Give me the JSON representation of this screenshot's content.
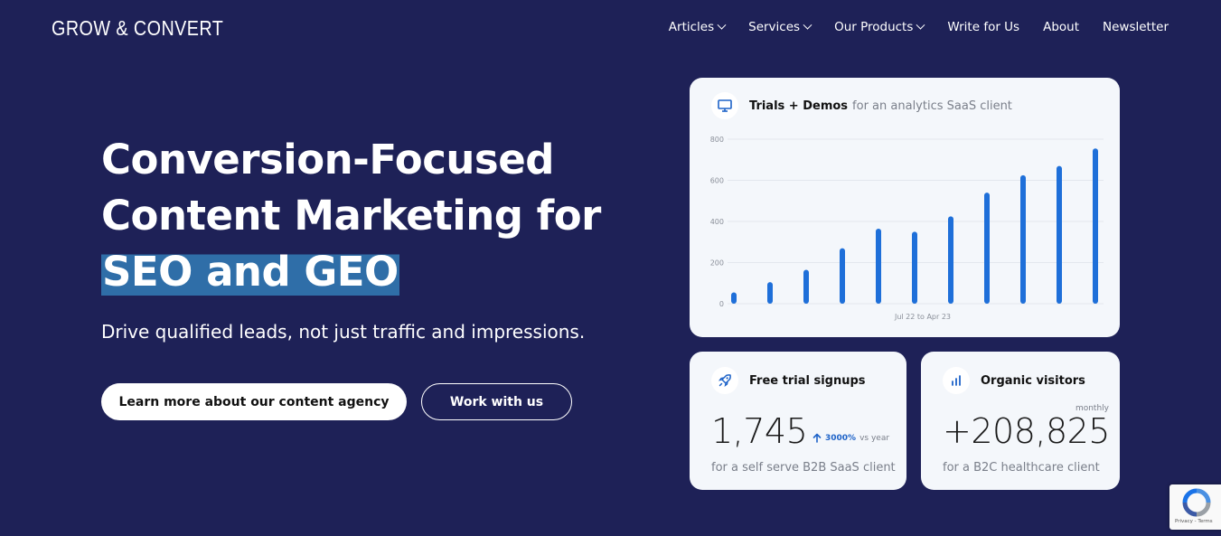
{
  "header": {
    "logo": "GROW & CONVERT",
    "nav": [
      {
        "label": "Articles",
        "dropdown": true
      },
      {
        "label": "Services",
        "dropdown": true
      },
      {
        "label": "Our Products",
        "dropdown": true
      },
      {
        "label": "Write for Us",
        "dropdown": false
      },
      {
        "label": "About",
        "dropdown": false
      },
      {
        "label": "Newsletter",
        "dropdown": false
      }
    ]
  },
  "hero": {
    "title_line1": "Conversion-Focused",
    "title_line2": "Content Marketing for",
    "title_highlight": "SEO and GEO",
    "subtitle": "Drive qualified leads, not just traffic and impressions.",
    "primary_button": "Learn more about our content agency",
    "secondary_button": "Work with us"
  },
  "chart_card": {
    "title": "Trials + Demos",
    "subtitle": "for an analytics SaaS client",
    "icon": "monitor-icon",
    "chart_data": {
      "type": "bar",
      "xlabel": "Jul 22 to Apr 23",
      "ylabel": "",
      "ylim": [
        0,
        800
      ],
      "yticks": [
        0,
        200,
        400,
        600,
        800
      ],
      "values": [
        55,
        105,
        165,
        270,
        365,
        350,
        425,
        540,
        625,
        670,
        755
      ],
      "grid": true,
      "bar_color": "#1e6fd9"
    }
  },
  "stat_signups": {
    "title": "Free trial signups",
    "icon": "rocket-icon",
    "value": "1,745",
    "growth_pct": "3000%",
    "growth_label": "vs year",
    "caption": "for a self serve B2B SaaS client"
  },
  "stat_visitors": {
    "title": "Organic visitors",
    "icon": "bar-chart-icon",
    "period": "monthly",
    "value": "+208,825",
    "caption": "for a B2C healthcare client"
  },
  "recaptcha": {
    "text": "Privacy - Terms"
  },
  "colors": {
    "background": "#1e2157",
    "highlight": "#2f6ea8",
    "accent_blue": "#1e63c8",
    "card_bg": "#f4f7fb"
  }
}
